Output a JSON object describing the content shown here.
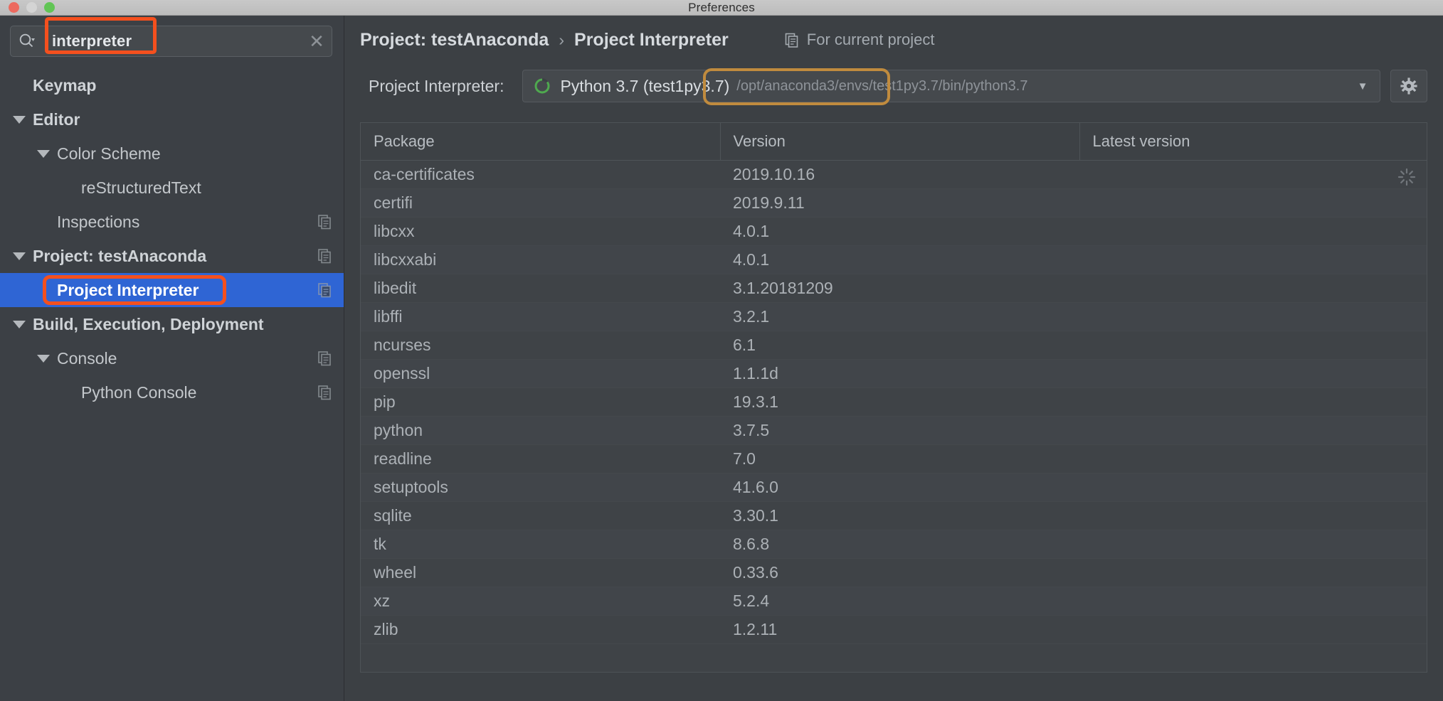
{
  "window": {
    "title": "Preferences",
    "traffic_lights": [
      "close-button",
      "minimize-button",
      "zoom-button"
    ]
  },
  "search": {
    "value": "interpreter",
    "placeholder": "",
    "icon": "search-icon",
    "clear_icon": "close-icon"
  },
  "sidebar": {
    "items": [
      {
        "label": "Keymap",
        "indent": 0,
        "arrow": "none",
        "bold": true,
        "selected": false,
        "badge": false
      },
      {
        "label": "Editor",
        "indent": 0,
        "arrow": "down",
        "bold": true,
        "selected": false,
        "badge": false
      },
      {
        "label": "Color Scheme",
        "indent": 1,
        "arrow": "down",
        "bold": false,
        "selected": false,
        "badge": false
      },
      {
        "label": "reStructuredText",
        "indent": 2,
        "arrow": "none",
        "bold": false,
        "selected": false,
        "badge": false
      },
      {
        "label": "Inspections",
        "indent": 1,
        "arrow": "none",
        "bold": false,
        "selected": false,
        "badge": true
      },
      {
        "label": "Project: testAnaconda",
        "indent": 0,
        "arrow": "down",
        "bold": true,
        "selected": false,
        "badge": true
      },
      {
        "label": "Project Interpreter",
        "indent": 1,
        "arrow": "none",
        "bold": true,
        "selected": true,
        "badge": true
      },
      {
        "label": "Build, Execution, Deployment",
        "indent": 0,
        "arrow": "down",
        "bold": true,
        "selected": false,
        "badge": false
      },
      {
        "label": "Console",
        "indent": 1,
        "arrow": "down",
        "bold": false,
        "selected": false,
        "badge": true
      },
      {
        "label": "Python Console",
        "indent": 2,
        "arrow": "none",
        "bold": false,
        "selected": false,
        "badge": true
      }
    ]
  },
  "breadcrumb": {
    "parent": "Project: testAnaconda",
    "separator": "›",
    "current": "Project Interpreter",
    "for_current_project": "For current project",
    "for_current_project_icon": "copy-icon"
  },
  "interpreter": {
    "label": "Project Interpreter:",
    "icon": "python-env-icon",
    "name": "Python 3.7 (test1py3.7)",
    "path": "/opt/anaconda3/envs/test1py3.7/bin/python3.7",
    "dropdown_icon": "chevron-down-icon",
    "settings_icon": "gear-icon"
  },
  "packages_table": {
    "columns": [
      "Package",
      "Version",
      "Latest version"
    ],
    "rows": [
      {
        "package": "ca-certificates",
        "version": "2019.10.16",
        "latest": ""
      },
      {
        "package": "certifi",
        "version": "2019.9.11",
        "latest": ""
      },
      {
        "package": "libcxx",
        "version": "4.0.1",
        "latest": ""
      },
      {
        "package": "libcxxabi",
        "version": "4.0.1",
        "latest": ""
      },
      {
        "package": "libedit",
        "version": "3.1.20181209",
        "latest": ""
      },
      {
        "package": "libffi",
        "version": "3.2.1",
        "latest": ""
      },
      {
        "package": "ncurses",
        "version": "6.1",
        "latest": ""
      },
      {
        "package": "openssl",
        "version": "1.1.1d",
        "latest": ""
      },
      {
        "package": "pip",
        "version": "19.3.1",
        "latest": ""
      },
      {
        "package": "python",
        "version": "3.7.5",
        "latest": ""
      },
      {
        "package": "readline",
        "version": "7.0",
        "latest": ""
      },
      {
        "package": "setuptools",
        "version": "41.6.0",
        "latest": ""
      },
      {
        "package": "sqlite",
        "version": "3.30.1",
        "latest": ""
      },
      {
        "package": "tk",
        "version": "8.6.8",
        "latest": ""
      },
      {
        "package": "wheel",
        "version": "0.33.6",
        "latest": ""
      },
      {
        "package": "xz",
        "version": "5.2.4",
        "latest": ""
      },
      {
        "package": "zlib",
        "version": "1.2.11",
        "latest": ""
      }
    ],
    "loading_icon": "spinner-icon"
  },
  "annotations": {
    "highlight_color": "#f4501e",
    "focus_color": "#c08b3e"
  },
  "colors": {
    "window_bg": "#3c4044",
    "sidebar_bg": "#3c4045",
    "selection_blue": "#2f65d4",
    "python_green": "#4fa94f"
  }
}
